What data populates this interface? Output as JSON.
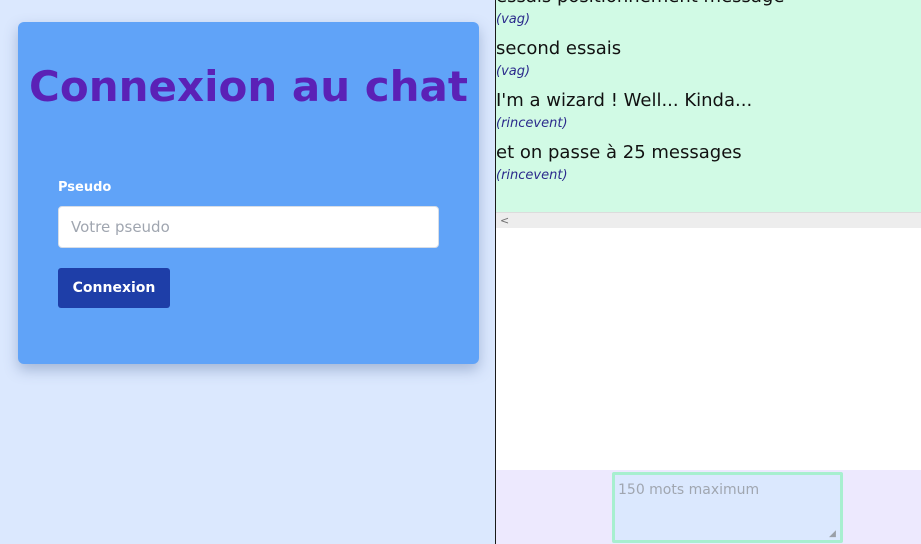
{
  "login": {
    "title": "Connexion au chat",
    "pseudo_label": "Pseudo",
    "pseudo_placeholder": "Votre pseudo",
    "pseudo_value": "",
    "button_label": "Connexion"
  },
  "chat": {
    "messages": [
      {
        "text": "essais positionnement message",
        "author": "(vag)"
      },
      {
        "text": "second essais",
        "author": "(vag)"
      },
      {
        "text": "I'm a wizard ! Well... Kinda...",
        "author": "(rincevent)"
      },
      {
        "text": "et on passe à 25 messages",
        "author": "(rincevent)"
      }
    ],
    "scroll_left_glyph": "<",
    "textarea_placeholder": "150 mots maximum",
    "textarea_value": "",
    "resize_grip_glyph": "◢"
  },
  "colors": {
    "page_bg": "#dbe8fe",
    "card_bg": "#60a3f8",
    "title_color": "#5b21b6",
    "button_bg": "#1e3ea8",
    "messages_bg": "#d1fae5",
    "author_color": "#2b2a8c",
    "compose_bg": "#ede9fe",
    "textarea_border": "#a7efcf"
  },
  "icons": {
    "scroll_left": "scroll-left-icon",
    "resize_grip": "resize-grip-icon"
  }
}
